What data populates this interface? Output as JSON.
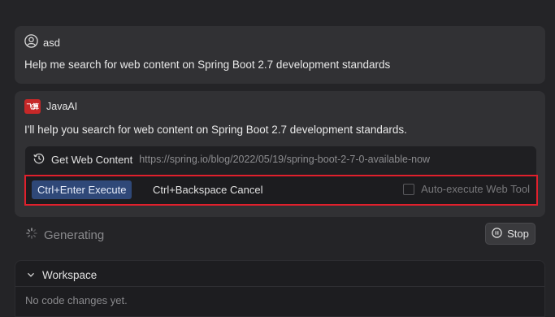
{
  "user_message": {
    "username": "asd",
    "text": "Help me search for web content on Spring Boot 2.7 development standards"
  },
  "ai_message": {
    "name": "JavaAI",
    "logo_text": "飞算",
    "text": "I'll help you search for web content on Spring Boot 2.7 development standards.",
    "tool_call": {
      "name": "Get Web Content",
      "url": "https://spring.io/blog/2022/05/19/spring-boot-2-7-0-available-now"
    }
  },
  "action_bar": {
    "execute_label": "Ctrl+Enter Execute",
    "cancel_label": "Ctrl+Backspace Cancel",
    "auto_execute_label": "Auto-execute Web Tool",
    "auto_execute_checked": false
  },
  "status": {
    "generating_label": "Generating",
    "stop_label": "Stop"
  },
  "workspace": {
    "title": "Workspace",
    "empty_text": "No code changes yet."
  },
  "colors": {
    "highlight_border": "#e0202c",
    "execute_button": "#2f4878",
    "logo": "#c62828"
  },
  "icons": [
    "user-icon",
    "history-icon",
    "spinner-icon",
    "pause-icon",
    "chevron-down-icon"
  ]
}
